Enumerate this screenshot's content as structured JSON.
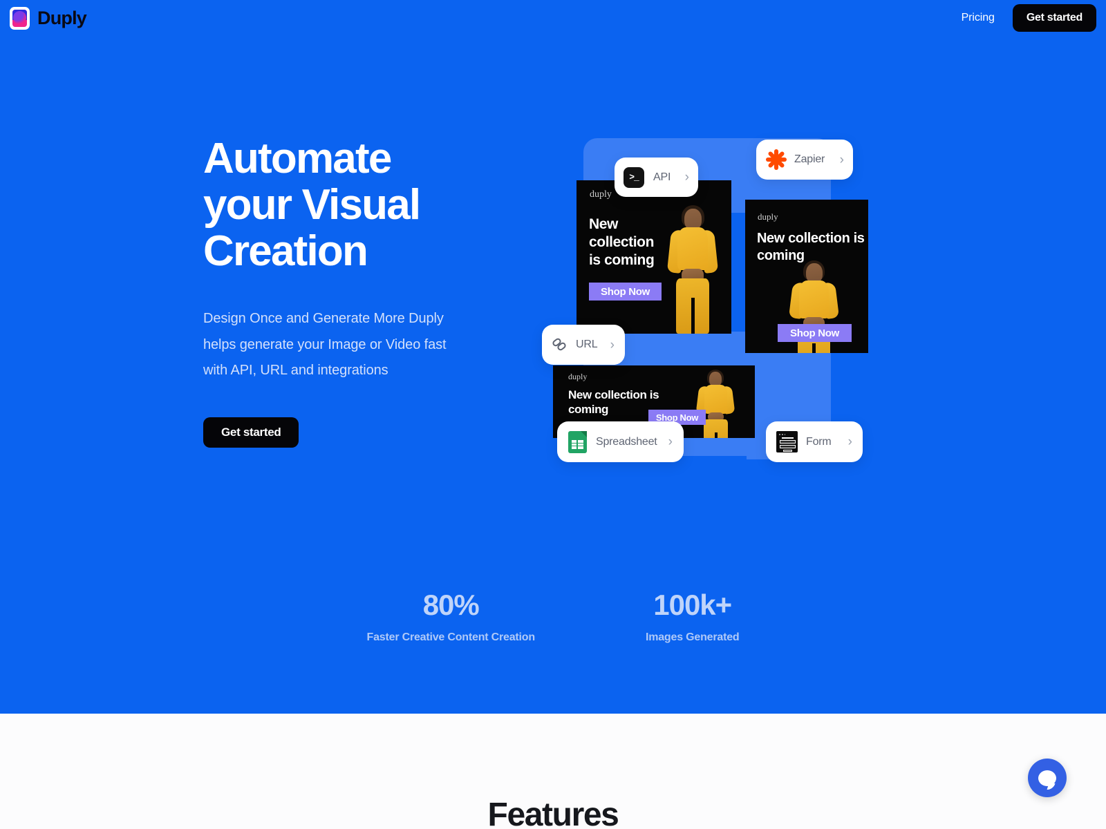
{
  "brand": {
    "name": "Duply",
    "logo_icon": "duply-logo-icon"
  },
  "nav": {
    "links": [
      {
        "label": "Pricing"
      }
    ],
    "cta_label": "Get started"
  },
  "hero": {
    "title_lines": [
      "Automate",
      "your Visual",
      "Creation"
    ],
    "title": "Automate your Visual Creation",
    "subtitle": "Design Once and Generate More Duply helps generate your Image or Video fast with API, URL and integrations",
    "cta_label": "Get started"
  },
  "graphic": {
    "chips": [
      {
        "label": "API",
        "icon": "terminal-icon",
        "chevron": "›"
      },
      {
        "label": "Zapier",
        "icon": "zapier-icon",
        "chevron": "›"
      },
      {
        "label": "URL",
        "icon": "link-icon",
        "chevron": "›"
      },
      {
        "label": "Spreadsheet",
        "icon": "google-sheets-icon",
        "chevron": "›"
      },
      {
        "label": "Form",
        "icon": "form-icon",
        "chevron": "›"
      }
    ],
    "creatives": [
      {
        "watermark": "duply",
        "headline": "New collection is coming",
        "button": "Shop Now"
      },
      {
        "watermark": "duply",
        "headline": "New collection is coming",
        "button": "Shop Now"
      },
      {
        "watermark": "duply",
        "headline": "New collection is coming",
        "button": "Shop Now"
      }
    ]
  },
  "stats": [
    {
      "value": "80%",
      "label": "Faster Creative Content Creation"
    },
    {
      "value": "100k+",
      "label": "Images Generated"
    }
  ],
  "features": {
    "title": "Features"
  },
  "chat": {
    "icon": "chat-bubble-icon",
    "aria": "Open chat"
  },
  "colors": {
    "brand_blue": "#0B63F0",
    "panel_blue": "#3A7DF4",
    "dark": "#050508",
    "shop_now_purple": "#8B7BF5",
    "zapier_orange": "#FF4A00",
    "sheets_green": "#21A464"
  }
}
